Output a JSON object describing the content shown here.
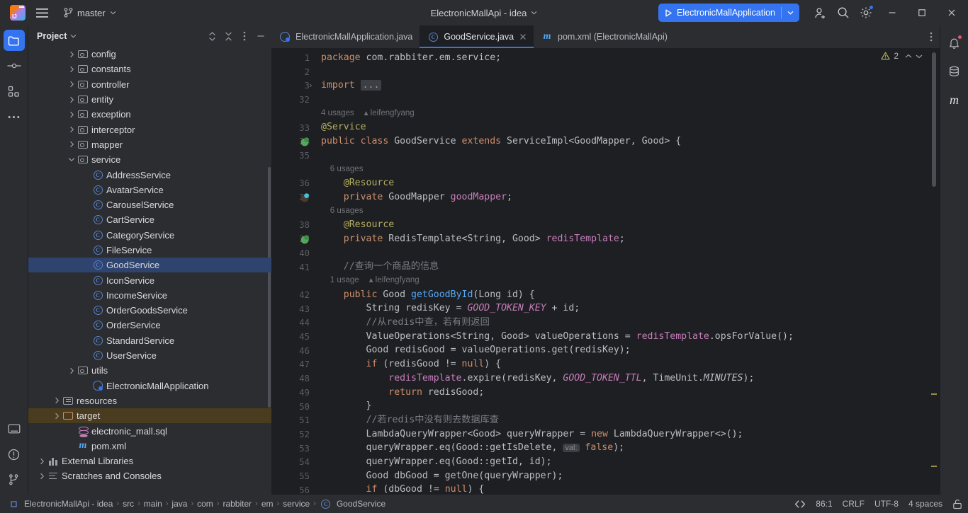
{
  "titlebar": {
    "app_icon": "intellij-logo",
    "menu_icon": "hamburger-menu-icon",
    "branch_icon": "git-branch-icon",
    "branch_label": "master",
    "branch_chevron": "chevron-down-icon",
    "project_title": "ElectronicMallApi - idea",
    "project_chevron": "chevron-down-icon",
    "run_config": {
      "run_icon": "play-icon",
      "label": "ElectronicMallApplication",
      "chevron": "chevron-down-icon",
      "color": "#3574f0"
    },
    "actions": [
      {
        "name": "add-user-icon"
      },
      {
        "name": "search-icon"
      },
      {
        "name": "gear-icon",
        "badge": true
      }
    ],
    "window_controls": [
      {
        "name": "minimize-button",
        "glyph": "–"
      },
      {
        "name": "maximize-button",
        "glyph": "□"
      },
      {
        "name": "close-button",
        "glyph": "✕"
      }
    ]
  },
  "left_toolstrip": {
    "top": [
      {
        "name": "project-tool-icon",
        "active": true
      },
      {
        "name": "commit-tool-icon",
        "active": false
      },
      {
        "name": "structure-tool-icon",
        "active": false
      },
      {
        "name": "more-tools-icon",
        "active": false
      }
    ],
    "bottom": [
      {
        "name": "terminal-tool-icon"
      },
      {
        "name": "problems-tool-icon"
      },
      {
        "name": "version-control-tool-icon"
      }
    ]
  },
  "project_panel": {
    "title": "Project",
    "title_chevron": "chevron-down-icon",
    "actions": [
      {
        "name": "expand-collapse-icon"
      },
      {
        "name": "collapse-all-icon"
      },
      {
        "name": "more-options-icon"
      },
      {
        "name": "hide-panel-icon"
      }
    ],
    "tree": [
      {
        "label": "config",
        "indent": 2,
        "arrow": "right",
        "icon": "package-folder-icon"
      },
      {
        "label": "constants",
        "indent": 2,
        "arrow": "right",
        "icon": "package-folder-icon"
      },
      {
        "label": "controller",
        "indent": 2,
        "arrow": "right",
        "icon": "package-folder-icon"
      },
      {
        "label": "entity",
        "indent": 2,
        "arrow": "right",
        "icon": "package-folder-icon"
      },
      {
        "label": "exception",
        "indent": 2,
        "arrow": "right",
        "icon": "package-folder-icon"
      },
      {
        "label": "interceptor",
        "indent": 2,
        "arrow": "right",
        "icon": "package-folder-icon"
      },
      {
        "label": "mapper",
        "indent": 2,
        "arrow": "right",
        "icon": "package-folder-icon"
      },
      {
        "label": "service",
        "indent": 2,
        "arrow": "down",
        "icon": "package-folder-icon"
      },
      {
        "label": "AddressService",
        "indent": 3,
        "arrow": "none",
        "icon": "java-class-icon"
      },
      {
        "label": "AvatarService",
        "indent": 3,
        "arrow": "none",
        "icon": "java-class-icon"
      },
      {
        "label": "CarouselService",
        "indent": 3,
        "arrow": "none",
        "icon": "java-class-icon"
      },
      {
        "label": "CartService",
        "indent": 3,
        "arrow": "none",
        "icon": "java-class-icon"
      },
      {
        "label": "CategoryService",
        "indent": 3,
        "arrow": "none",
        "icon": "java-class-icon"
      },
      {
        "label": "FileService",
        "indent": 3,
        "arrow": "none",
        "icon": "java-class-icon"
      },
      {
        "label": "GoodService",
        "indent": 3,
        "arrow": "none",
        "icon": "java-class-icon",
        "state": "selected"
      },
      {
        "label": "IconService",
        "indent": 3,
        "arrow": "none",
        "icon": "java-class-icon"
      },
      {
        "label": "IncomeService",
        "indent": 3,
        "arrow": "none",
        "icon": "java-class-icon"
      },
      {
        "label": "OrderGoodsService",
        "indent": 3,
        "arrow": "none",
        "icon": "java-class-icon"
      },
      {
        "label": "OrderService",
        "indent": 3,
        "arrow": "none",
        "icon": "java-class-icon"
      },
      {
        "label": "StandardService",
        "indent": 3,
        "arrow": "none",
        "icon": "java-class-icon"
      },
      {
        "label": "UserService",
        "indent": 3,
        "arrow": "none",
        "icon": "java-class-icon"
      },
      {
        "label": "utils",
        "indent": 2,
        "arrow": "right",
        "icon": "package-folder-icon"
      },
      {
        "label": "ElectronicMallApplication",
        "indent": 3,
        "arrow": "none",
        "icon": "spring-boot-class-icon"
      },
      {
        "label": "resources",
        "indent": 1,
        "arrow": "right",
        "icon": "resources-folder-icon"
      },
      {
        "label": "target",
        "indent": 1,
        "arrow": "right",
        "icon": "excluded-folder-icon",
        "state": "highlight"
      },
      {
        "label": "electronic_mall.sql",
        "indent": 2,
        "arrow": "none",
        "icon": "sql-file-icon"
      },
      {
        "label": "pom.xml",
        "indent": 2,
        "arrow": "none",
        "icon": "maven-file-icon"
      },
      {
        "label": "External Libraries",
        "indent": 0,
        "arrow": "right",
        "icon": "libraries-icon"
      },
      {
        "label": "Scratches and Consoles",
        "indent": 0,
        "arrow": "right",
        "icon": "scratches-icon"
      }
    ]
  },
  "editor": {
    "tabs": [
      {
        "label": "ElectronicMallApplication.java",
        "icon": "spring-boot-class-icon",
        "active": false,
        "closable": false
      },
      {
        "label": "GoodService.java",
        "icon": "java-class-icon",
        "active": true,
        "closable": true
      },
      {
        "label": "pom.xml (ElectronicMallApi)",
        "icon": "maven-file-icon",
        "active": false,
        "closable": false
      }
    ],
    "tab_overflow_icon": "more-options-icon",
    "inspection": {
      "warning_icon": "warning-triangle-icon",
      "warning_count": "2",
      "prev_icon": "chevron-up-icon",
      "next_icon": "chevron-down-icon"
    },
    "lines": [
      {
        "num": "1",
        "gutter": "",
        "tokens": [
          {
            "t": "package ",
            "c": "kw"
          },
          {
            "t": "com.rabbiter.em.service;",
            "c": "txt"
          }
        ]
      },
      {
        "num": "2",
        "gutter": "",
        "tokens": []
      },
      {
        "num": "3",
        "gutter": "",
        "fold": "›",
        "tokens": [
          {
            "t": "import ",
            "c": "kw"
          },
          {
            "t": "...",
            "c": "foldchip"
          }
        ]
      },
      {
        "num": "32",
        "gutter": "",
        "tokens": []
      },
      {
        "hint": "4 usages",
        "author": "leifengfyang",
        "indent": 0
      },
      {
        "num": "33",
        "gutter": "",
        "tokens": [
          {
            "t": "@Service",
            "c": "ann"
          }
        ]
      },
      {
        "num": "34",
        "gutter": "spring-bean-icon",
        "tokens": [
          {
            "t": "public ",
            "c": "kw"
          },
          {
            "t": "class ",
            "c": "kw"
          },
          {
            "t": "GoodService ",
            "c": "typ"
          },
          {
            "t": "extends ",
            "c": "kw"
          },
          {
            "t": "ServiceImpl<GoodMapper, Good> {",
            "c": "typ"
          }
        ]
      },
      {
        "num": "35",
        "gutter": "",
        "tokens": []
      },
      {
        "hint": "6 usages",
        "author": "",
        "indent": 1
      },
      {
        "num": "36",
        "gutter": "",
        "tokens": [
          {
            "t": "    ",
            "c": "txt"
          },
          {
            "t": "@Resource",
            "c": "ann"
          }
        ]
      },
      {
        "num": "37",
        "gutter": "bean-icon",
        "tokens": [
          {
            "t": "    ",
            "c": "txt"
          },
          {
            "t": "private ",
            "c": "kw"
          },
          {
            "t": "GoodMapper ",
            "c": "typ"
          },
          {
            "t": "goodMapper",
            "c": "fld"
          },
          {
            "t": ";",
            "c": "txt"
          }
        ]
      },
      {
        "hint": "6 usages",
        "author": "",
        "indent": 1
      },
      {
        "num": "38",
        "gutter": "",
        "tokens": [
          {
            "t": "    ",
            "c": "txt"
          },
          {
            "t": "@Resource",
            "c": "ann"
          }
        ]
      },
      {
        "num": "39",
        "gutter": "redis-icon",
        "tokens": [
          {
            "t": "    ",
            "c": "txt"
          },
          {
            "t": "private ",
            "c": "kw"
          },
          {
            "t": "RedisTemplate<String, Good> ",
            "c": "typ"
          },
          {
            "t": "redisTemplate",
            "c": "fld"
          },
          {
            "t": ";",
            "c": "txt"
          }
        ]
      },
      {
        "num": "40",
        "gutter": "",
        "tokens": []
      },
      {
        "num": "41",
        "gutter": "",
        "tokens": [
          {
            "t": "    //查询一个商品的信息",
            "c": "cmt"
          }
        ]
      },
      {
        "hint": "1 usage",
        "author": "leifengfyang",
        "indent": 1
      },
      {
        "num": "42",
        "gutter": "",
        "tokens": [
          {
            "t": "    ",
            "c": "txt"
          },
          {
            "t": "public ",
            "c": "kw"
          },
          {
            "t": "Good ",
            "c": "typ"
          },
          {
            "t": "getGoodById",
            "c": "mth"
          },
          {
            "t": "(Long id) {",
            "c": "txt"
          }
        ]
      },
      {
        "num": "43",
        "gutter": "",
        "tokens": [
          {
            "t": "        String redisKey = ",
            "c": "txt"
          },
          {
            "t": "GOOD_TOKEN_KEY",
            "c": "stc"
          },
          {
            "t": " + id;",
            "c": "txt"
          }
        ]
      },
      {
        "num": "44",
        "gutter": "",
        "tokens": [
          {
            "t": "        //从redis中查，若有则返回",
            "c": "cmt"
          }
        ]
      },
      {
        "num": "45",
        "gutter": "",
        "tokens": [
          {
            "t": "        ValueOperations<String, Good> valueOperations = ",
            "c": "txt"
          },
          {
            "t": "redisTemplate",
            "c": "fld"
          },
          {
            "t": ".opsForValue();",
            "c": "txt"
          }
        ]
      },
      {
        "num": "46",
        "gutter": "",
        "tokens": [
          {
            "t": "        Good redisGood = valueOperations.get(redisKey);",
            "c": "txt"
          }
        ]
      },
      {
        "num": "47",
        "gutter": "",
        "tokens": [
          {
            "t": "        ",
            "c": "txt"
          },
          {
            "t": "if ",
            "c": "kw"
          },
          {
            "t": "(redisGood != ",
            "c": "txt"
          },
          {
            "t": "null",
            "c": "kw"
          },
          {
            "t": ") {",
            "c": "txt"
          }
        ]
      },
      {
        "num": "48",
        "gutter": "",
        "tokens": [
          {
            "t": "            ",
            "c": "txt"
          },
          {
            "t": "redisTemplate",
            "c": "fld"
          },
          {
            "t": ".expire(redisKey, ",
            "c": "txt"
          },
          {
            "t": "GOOD_TOKEN_TTL",
            "c": "stc"
          },
          {
            "t": ", TimeUnit.",
            "c": "txt"
          },
          {
            "t": "MINUTES",
            "c": "stcu"
          },
          {
            "t": ");",
            "c": "txt"
          }
        ]
      },
      {
        "num": "49",
        "gutter": "",
        "tokens": [
          {
            "t": "            ",
            "c": "txt"
          },
          {
            "t": "return ",
            "c": "kw"
          },
          {
            "t": "redisGood;",
            "c": "txt"
          }
        ]
      },
      {
        "num": "50",
        "gutter": "",
        "tokens": [
          {
            "t": "        }",
            "c": "txt"
          }
        ]
      },
      {
        "num": "51",
        "gutter": "",
        "tokens": [
          {
            "t": "        //若redis中没有则去数据库查",
            "c": "cmt"
          }
        ]
      },
      {
        "num": "52",
        "gutter": "",
        "tokens": [
          {
            "t": "        LambdaQueryWrapper<Good> queryWrapper = ",
            "c": "txt"
          },
          {
            "t": "new ",
            "c": "kw"
          },
          {
            "t": "LambdaQueryWrapper<>();",
            "c": "txt"
          }
        ]
      },
      {
        "num": "53",
        "gutter": "",
        "tokens": [
          {
            "t": "        queryWrapper.eq(Good::getIsDelete, ",
            "c": "txt"
          },
          {
            "t": "val:",
            "c": "hintchip"
          },
          {
            "t": " ",
            "c": "txt"
          },
          {
            "t": "false",
            "c": "kw"
          },
          {
            "t": ");",
            "c": "txt"
          }
        ]
      },
      {
        "num": "54",
        "gutter": "",
        "tokens": [
          {
            "t": "        queryWrapper.eq(Good::getId, id);",
            "c": "txt"
          }
        ]
      },
      {
        "num": "55",
        "gutter": "",
        "tokens": [
          {
            "t": "        Good dbGood = getOne(queryWrapper);",
            "c": "txt"
          }
        ]
      },
      {
        "num": "56",
        "gutter": "",
        "tokens": [
          {
            "t": "        ",
            "c": "txt"
          },
          {
            "t": "if ",
            "c": "kw"
          },
          {
            "t": "(dbGood != ",
            "c": "txt"
          },
          {
            "t": "null",
            "c": "kw"
          },
          {
            "t": ") {",
            "c": "txt"
          }
        ]
      }
    ]
  },
  "right_toolstrip": [
    {
      "name": "notifications-icon",
      "badge": true
    },
    {
      "name": "database-icon",
      "badge": false
    },
    {
      "name": "maven-icon",
      "badge": false
    }
  ],
  "statusbar": {
    "project_icon": "module-icon",
    "breadcrumbs": [
      "ElectronicMallApi - idea",
      "src",
      "main",
      "java",
      "com",
      "rabbiter",
      "em",
      "service",
      "GoodService"
    ],
    "breadcrumb_last_icon": "java-class-icon",
    "right": {
      "code_style_icon": "code-brackets-icon",
      "caret": "86:1",
      "line_separator": "CRLF",
      "encoding": "UTF-8",
      "indent": "4 spaces",
      "lock_icon": "unlocked-icon"
    }
  }
}
